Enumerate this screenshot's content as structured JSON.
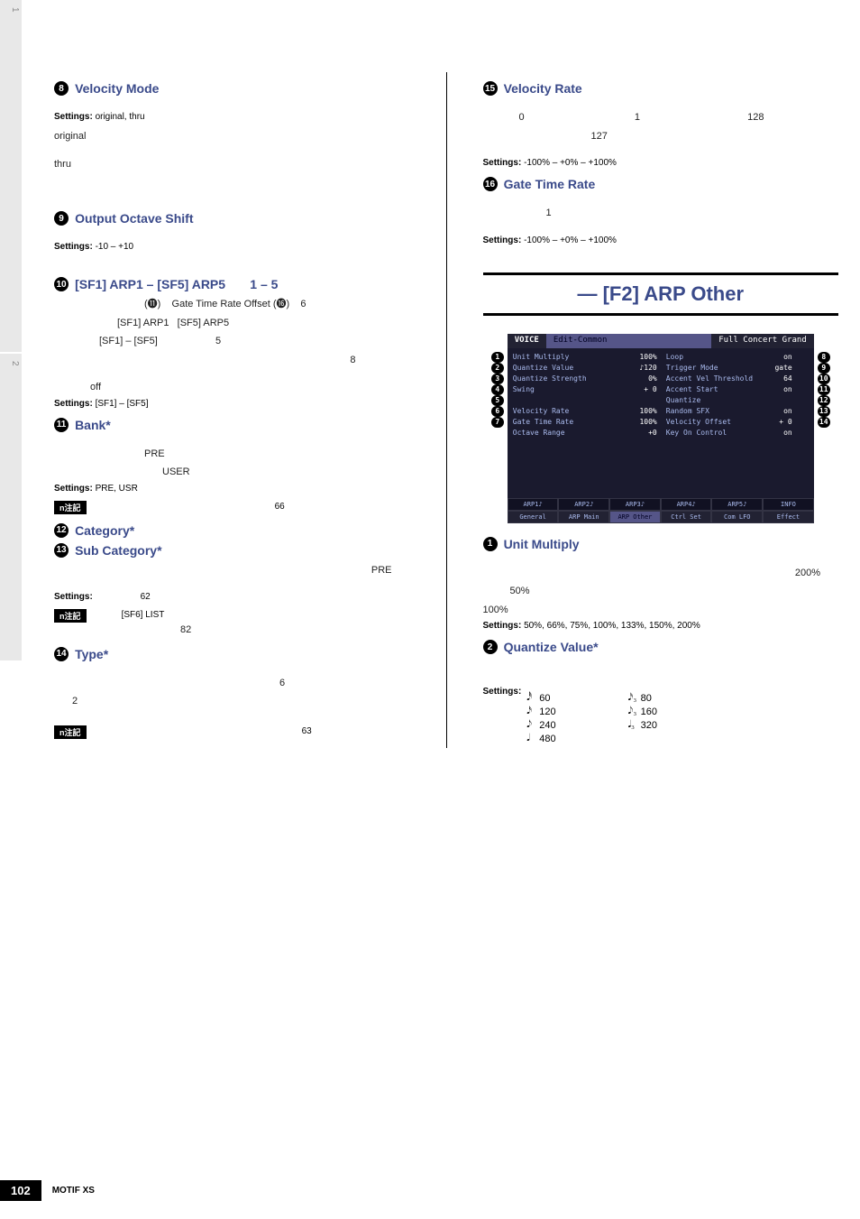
{
  "side": {
    "tab1": "1",
    "tab2": "2"
  },
  "left": {
    "h8": {
      "num": "8",
      "title": "Velocity Mode"
    },
    "p8a_label": "Settings:",
    "p8a_val": "original, thru",
    "p8b": "original",
    "p8c": "thru",
    "h9": {
      "num": "9",
      "title": "Output Octave Shift"
    },
    "p9_label": "Settings:",
    "p9_val": "-10 – +10",
    "h10": {
      "num": "10",
      "title": "[SF1] ARP1 – [SF5] ARP5       1 – 5"
    },
    "p10a": "(⓫)    Gate Time Rate Offset (⓰)    6",
    "p10b": "[SF1] ARP1   [SF5] ARP5",
    "p10c": "[SF1] – [SF5]                     5",
    "p10d": "8",
    "p10e": "off",
    "p10f_label": "Settings:",
    "p10f_val": "[SF1] – [SF5]",
    "h11": {
      "num": "11",
      "title": "Bank*"
    },
    "p11a": "PRE",
    "p11b": "USER",
    "p11c_label": "Settings:",
    "p11c_val": "PRE, USR",
    "note11_label": "n注記",
    "note11_text": "66",
    "h12": {
      "num": "12",
      "title": "Category*"
    },
    "h13": {
      "num": "13",
      "title": "Sub Category*"
    },
    "p13a": "PRE",
    "p13b_label": "Settings:",
    "p13b_val": "62",
    "note13_label": "n注記",
    "note13_text1": "[SF6] LIST",
    "note13_text2": "82",
    "h14": {
      "num": "14",
      "title": "Type*"
    },
    "p14a": "6",
    "p14b": "2",
    "note14_label": "n注記",
    "note14_text": "63"
  },
  "right": {
    "h15": {
      "num": "15",
      "title": "Velocity Rate"
    },
    "p15a": "0                                        1                                       128",
    "p15b": "127",
    "p15c_label": "Settings:",
    "p15c_val": "-100% – +0% – +100%",
    "h16": {
      "num": "16",
      "title": "Gate Time Rate"
    },
    "p16a": "1",
    "p16b_label": "Settings:",
    "p16b_val": "-100% – +0% – +100%",
    "section_title": "— [F2] ARP Other",
    "screen": {
      "voice": "VOICE",
      "edit": "Edit-Common",
      "name": "Full Concert Grand",
      "rows": [
        {
          "l1": "Unit Multiply",
          "v1": "100%",
          "l2": "Loop",
          "v2": "on"
        },
        {
          "l1": "Quantize Value",
          "v1": "♪120",
          "l2": "Trigger Mode",
          "v2": "gate"
        },
        {
          "l1": "Quantize Strength",
          "v1": "0%",
          "l2": "Accent Vel Threshold",
          "v2": "64"
        },
        {
          "l1": "Swing",
          "v1": "+ 0",
          "l2": "Accent Start Quantize",
          "v2": "on"
        },
        {
          "l1": "Velocity Rate",
          "v1": "100%",
          "l2": "Random SFX",
          "v2": "on"
        },
        {
          "l1": "Gate Time Rate",
          "v1": "100%",
          "l2": "Velocity Offset",
          "v2": "+ 0"
        },
        {
          "l1": "Octave Range",
          "v1": "+0",
          "l2": "Key On Control",
          "v2": "on"
        }
      ],
      "tabs_top": [
        "ARP1♪",
        "ARP2♪",
        "ARP3♪",
        "ARP4♪",
        "ARP5♪",
        "INFO"
      ],
      "tabs_bot": [
        "General",
        "ARP Main",
        "ARP Other",
        "Ctrl Set",
        "Com LFO",
        "Effect"
      ]
    },
    "callouts_left": [
      "1",
      "2",
      "3",
      "4",
      "5",
      "6",
      "7"
    ],
    "callouts_right": [
      "8",
      "9",
      "10",
      "11",
      "12",
      "13",
      "14"
    ],
    "h1b": {
      "num": "1",
      "title": "Unit Multiply"
    },
    "p1b_a": "200%",
    "p1b_b": "50%",
    "p1b_c": "100%",
    "p1b_label": "Settings:",
    "p1b_val": "50%, 66%, 75%, 100%, 133%, 150%, 200%",
    "h2b": {
      "num": "2",
      "title": "Quantize Value*"
    },
    "p2b_label": "Settings:",
    "quantize": {
      "left": [
        {
          "icon": "𝅘𝅥𝅰",
          "val": "60"
        },
        {
          "icon": "𝅘𝅥𝅯",
          "val": "120"
        },
        {
          "icon": "𝅘𝅥𝅮",
          "val": "240"
        },
        {
          "icon": "𝅘𝅥",
          "val": "480"
        }
      ],
      "right": [
        {
          "icon": "𝅘𝅥𝅯₃",
          "val": "80"
        },
        {
          "icon": "𝅘𝅥𝅮₃",
          "val": "160"
        },
        {
          "icon": "𝅘𝅥₃",
          "val": "320"
        }
      ]
    }
  },
  "footer": {
    "page": "102",
    "text": "MOTIF XS"
  }
}
